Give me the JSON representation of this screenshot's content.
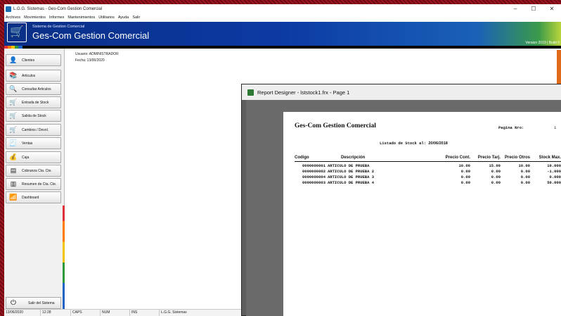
{
  "window": {
    "title": "L.G.G. Sistemas - Ges-Com Gestion Comercial",
    "controls": [
      "–",
      "☐",
      "✕"
    ]
  },
  "menu": [
    "Archivos",
    "Movimientos",
    "Informes",
    "Mantenimientos",
    "Utilitarios",
    "Ayuda",
    "Salir"
  ],
  "banner": {
    "subtitle": "Sistema de Gestion Comercial",
    "title": "Ges-Com Gestion Comercial",
    "version": "Version 2019 | Build 0"
  },
  "sidebar": {
    "items": [
      {
        "label": "Clientes",
        "icon": "user-icon",
        "glyph": "👤"
      },
      {
        "label": "Articulos",
        "icon": "books-icon",
        "glyph": "📚"
      },
      {
        "label": "Consultar Articulos",
        "icon": "search-icon",
        "glyph": "🔍"
      },
      {
        "label": "Entrada de Stock",
        "icon": "cart-icon",
        "glyph": "🛒"
      },
      {
        "label": "Salida de Stock",
        "icon": "cart-icon",
        "glyph": "🛒"
      },
      {
        "label": "Cambios / Devol.",
        "icon": "cart-icon",
        "glyph": "🛒"
      },
      {
        "label": "Ventas",
        "icon": "register-icon",
        "glyph": "🧾"
      },
      {
        "label": "Caja",
        "icon": "cashbox-icon",
        "glyph": "💰"
      },
      {
        "label": "Cobranza Cta. Cte.",
        "icon": "ledger-icon",
        "glyph": "▤"
      },
      {
        "label": "Resumen de Cta. Cte.",
        "icon": "statement-icon",
        "glyph": "▥"
      },
      {
        "label": "Dashboard",
        "icon": "bar-chart-icon",
        "glyph": "📶"
      }
    ],
    "exit_label": "Salir del Sistema"
  },
  "user": {
    "user_line": "Usuario:  ADMINISTRADOR",
    "date_line": "Fecha:   13/06/2020"
  },
  "status": [
    "13/06/2020",
    "12:28",
    "CAPS",
    "NUM",
    "INS",
    "L.G.G. Sistemas"
  ],
  "report": {
    "window_title": "Report Designer - lststock1.frx - Page 1",
    "company": "Ges-Com Gestion Comercial",
    "page_label": "Pagina Nro:",
    "page_number": "1",
    "title_prefix": "Listado de Stock al:",
    "title_date": "20/06/2018",
    "columns": [
      "Codigo",
      "Descripción",
      "Precio Cont.",
      "Precio Tarj.",
      "Precio Otros",
      "Stock Max."
    ],
    "rows": [
      [
        "0000000001",
        "ARTICULO DE PRUEBA",
        "10.00",
        "15.00",
        "10.00",
        "10.000"
      ],
      [
        "0000000002",
        "ARTICULO DE PRUEBA 2",
        "0.00",
        "0.00",
        "0.00",
        "-1.000"
      ],
      [
        "0000000004",
        "ARTICULO DE PRUEBA 3",
        "0.00",
        "0.00",
        "0.00",
        "0.000"
      ],
      [
        "0000000003",
        "ARTICULO DE PRUEBA 4",
        "0.00",
        "0.00",
        "0.00",
        "50.000"
      ]
    ]
  },
  "colors": {
    "banner_blue": "#0c3aa3",
    "desktop_red": "#8a0f1a"
  }
}
